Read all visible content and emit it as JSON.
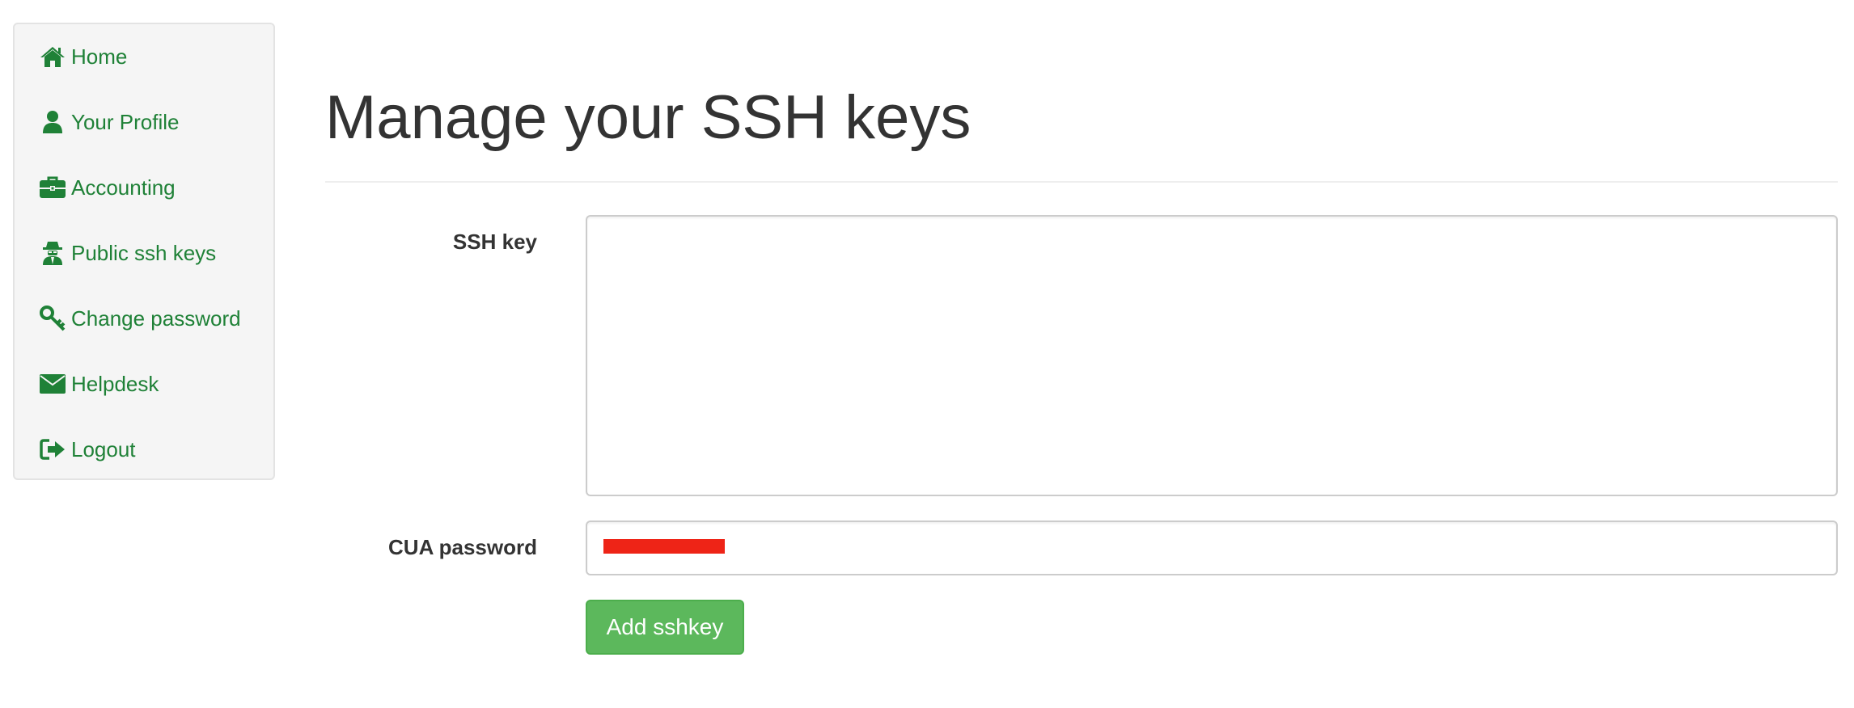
{
  "sidebar": {
    "items": [
      {
        "label": "Home",
        "icon": "home-icon"
      },
      {
        "label": "Your Profile",
        "icon": "user-icon"
      },
      {
        "label": "Accounting",
        "icon": "briefcase-icon"
      },
      {
        "label": "Public ssh keys",
        "icon": "user-secret-icon"
      },
      {
        "label": "Change password",
        "icon": "key-icon"
      },
      {
        "label": "Helpdesk",
        "icon": "envelope-icon"
      },
      {
        "label": "Logout",
        "icon": "sign-out-icon"
      }
    ]
  },
  "main": {
    "title": "Manage your SSH keys",
    "form": {
      "ssh_key_label": "SSH key",
      "ssh_key_value": "",
      "password_label": "CUA password",
      "submit_label": "Add sshkey"
    }
  },
  "colors": {
    "link": "#1f8137",
    "button": "#5cb85c",
    "sidebar_bg": "#f5f5f5",
    "redaction": "#ee2417"
  }
}
